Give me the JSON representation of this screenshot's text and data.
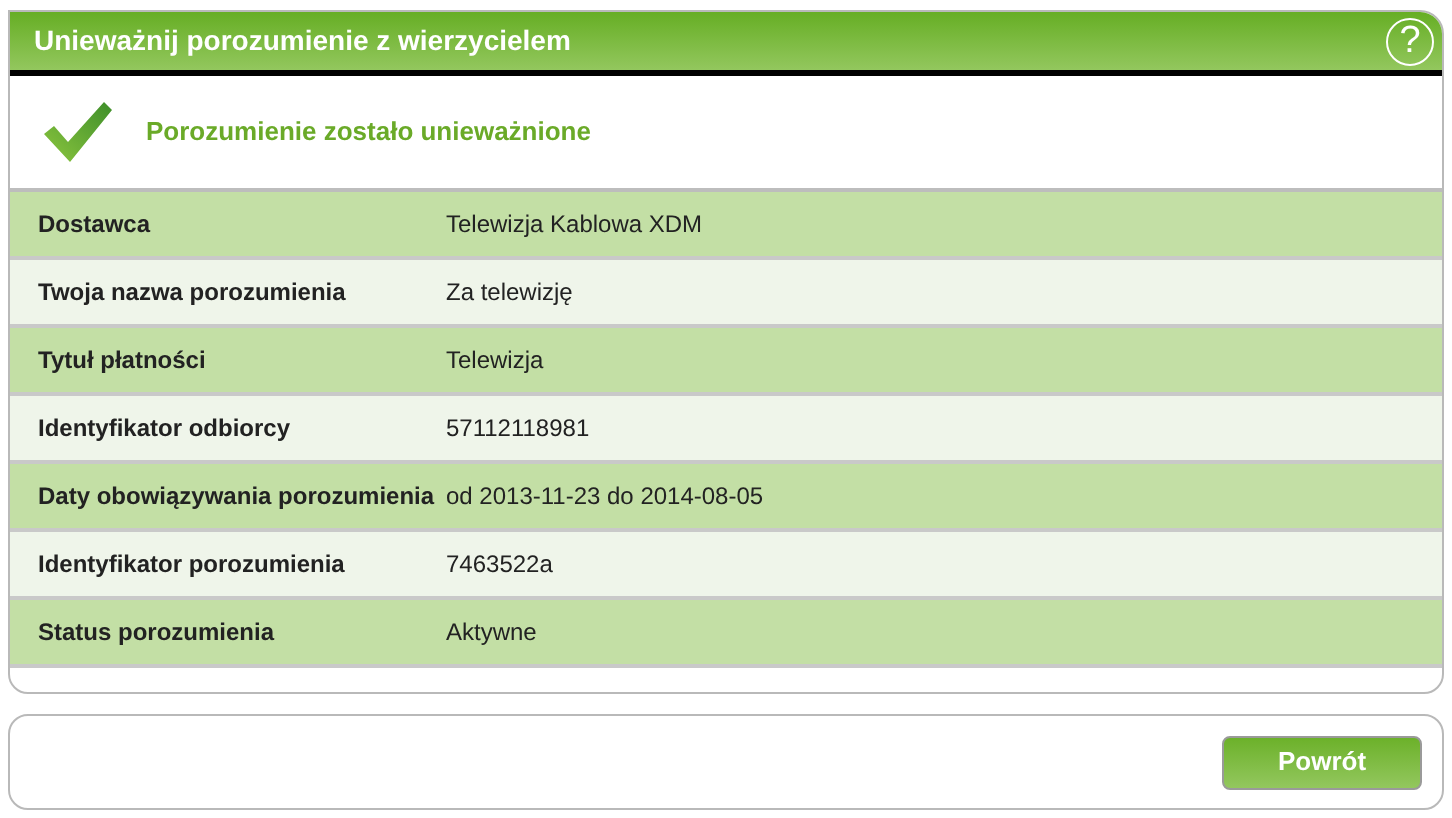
{
  "panel": {
    "title": "Unieważnij porozumienie z wierzycielem",
    "help": "?"
  },
  "message": {
    "text": "Porozumienie zostało unieważnione"
  },
  "details": [
    {
      "label": "Dostawca",
      "value": "Telewizja Kablowa XDM"
    },
    {
      "label": "Twoja nazwa porozumienia",
      "value": "Za telewizję"
    },
    {
      "label": "Tytuł płatności",
      "value": "Telewizja"
    },
    {
      "label": "Identyfikator odbiorcy",
      "value": "57112118981"
    },
    {
      "label": "Daty obowiązywania porozumienia",
      "value": "od 2013-11-23 do 2014-08-05"
    },
    {
      "label": "Identyfikator porozumienia",
      "value": "7463522a"
    },
    {
      "label": "Status porozumienia",
      "value": "Aktywne"
    }
  ],
  "buttons": [
    {
      "label": "Powrót"
    }
  ]
}
